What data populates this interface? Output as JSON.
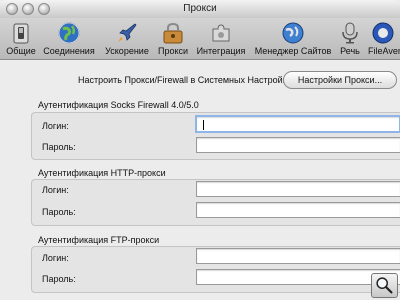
{
  "window": {
    "title": "Прокси"
  },
  "toolbar": {
    "items": [
      {
        "label": "Общие",
        "icon": "switch-icon"
      },
      {
        "label": "Соединения",
        "icon": "globe-icon"
      },
      {
        "label": "Ускорение",
        "icon": "rocket-icon"
      },
      {
        "label": "Прокси",
        "icon": "proxy-lock-icon"
      },
      {
        "label": "Интеграция",
        "icon": "puzzle-icon"
      },
      {
        "label": "Менеджер Сайтов",
        "icon": "site-manager-globe-icon"
      },
      {
        "label": "Речь",
        "icon": "microphone-icon"
      },
      {
        "label": "FileAven",
        "icon": "fileaven-icon"
      }
    ]
  },
  "proxy_settings": {
    "label": "Настроить Прокси/Firewall в Системных Настройках:",
    "button_label": "Настройки Прокси..."
  },
  "groups": {
    "socks": {
      "title": "Аутентификация Socks Firewall 4.0/5.0",
      "login_label": "Логин:",
      "password_label": "Пароль:",
      "login_value": "",
      "password_value": ""
    },
    "http": {
      "title": "Аутентификация HTTP-прокси",
      "login_label": "Логин:",
      "password_label": "Пароль:",
      "login_value": "",
      "password_value": ""
    },
    "ftp": {
      "title": "Аутентификация FTP-прокси",
      "login_label": "Логин:",
      "password_label": "Пароль:",
      "login_value": "",
      "password_value": ""
    }
  },
  "colors": {
    "toolbar_bg": "#c8c8c8",
    "group_bg": "#e4e4e4",
    "focus_ring": "#8fb5e8"
  }
}
